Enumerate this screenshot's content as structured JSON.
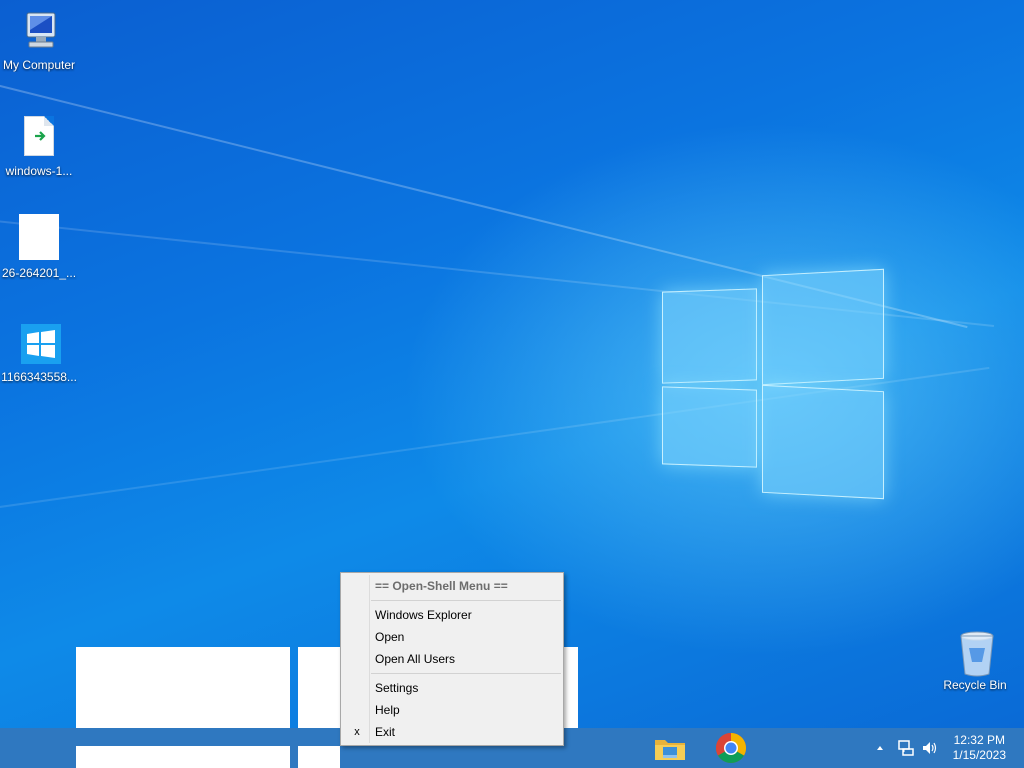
{
  "desktop": {
    "icons": [
      {
        "label": "My Computer",
        "icon": "computer-icon"
      },
      {
        "label": "windows-1...",
        "icon": "file-icon"
      },
      {
        "label": "26-264201_...",
        "icon": "blank-file-icon"
      },
      {
        "label": "1166343558...",
        "icon": "windows-logo-icon"
      },
      {
        "label": "Recycle Bin",
        "icon": "recycle-bin-icon"
      }
    ]
  },
  "context_menu": {
    "header": "== Open-Shell Menu ==",
    "items": [
      {
        "label": "Windows Explorer",
        "mark": ""
      },
      {
        "label": "Open",
        "mark": ""
      },
      {
        "label": "Open All Users",
        "mark": ""
      },
      {
        "label": "Settings",
        "mark": ""
      },
      {
        "label": "Help",
        "mark": ""
      },
      {
        "label": "Exit",
        "mark": "x"
      }
    ]
  },
  "taskbar": {
    "pinned": [
      {
        "icon": "file-explorer-icon"
      },
      {
        "icon": "chrome-icon"
      }
    ],
    "tray": {
      "time": "12:32 PM",
      "date": "1/15/2023",
      "icons": [
        "show-hidden-icons-chevron",
        "network-icon",
        "volume-icon"
      ]
    }
  },
  "colors": {
    "desktop_blue": "#0b74e0",
    "taskbar": "#2f78c0",
    "menu_bg": "#f0f0f0"
  }
}
